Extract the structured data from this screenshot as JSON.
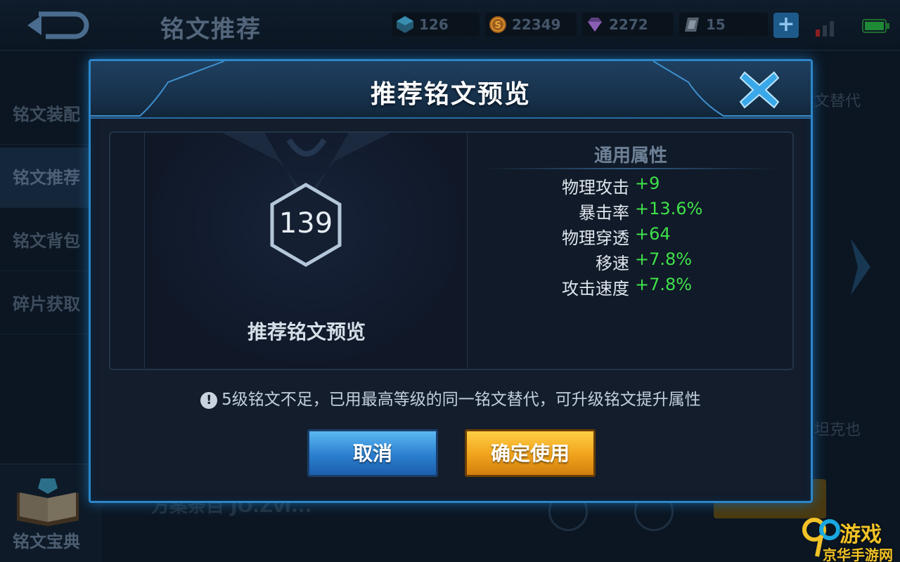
{
  "header": {
    "page_title": "铭文推荐",
    "currencies": [
      {
        "icon": "blue-gem-icon",
        "value": "126",
        "color": "#3a8fb0"
      },
      {
        "icon": "gold-coin-icon",
        "value": "22349",
        "color": "#d8902a"
      },
      {
        "icon": "purple-diamond-icon",
        "value": "2272",
        "color": "#8a5fb5"
      },
      {
        "icon": "silver-ticket-icon",
        "value": "15",
        "color": "#8a95a3"
      }
    ]
  },
  "sidebar": {
    "items": [
      {
        "label": "铭文装配"
      },
      {
        "label": "铭文推荐"
      },
      {
        "label": "铭文背包"
      },
      {
        "label": "碎片获取"
      }
    ],
    "book_label": "铭文宝典"
  },
  "background": {
    "right_text_1": "文替代",
    "right_text_2": "坦克也",
    "bottom_text": "方案条目 JO.Zvi..."
  },
  "modal": {
    "title": "推荐铭文预览",
    "rune_level": "139",
    "preview_label": "推荐铭文预览",
    "attr_title": "通用属性",
    "attributes": [
      {
        "name": "物理攻击",
        "value": "+9"
      },
      {
        "name": "暴击率",
        "value": "+13.6%"
      },
      {
        "name": "物理穿透",
        "value": "+64"
      },
      {
        "name": "移速",
        "value": "+7.8%"
      },
      {
        "name": "攻击速度",
        "value": "+7.8%"
      }
    ],
    "notice": "5级铭文不足，已用最高等级的同一铭文替代，可升级铭文提升属性",
    "cancel_label": "取消",
    "confirm_label": "确定使用"
  },
  "watermark": {
    "top": "游戏",
    "bottom": "京华手游网"
  }
}
